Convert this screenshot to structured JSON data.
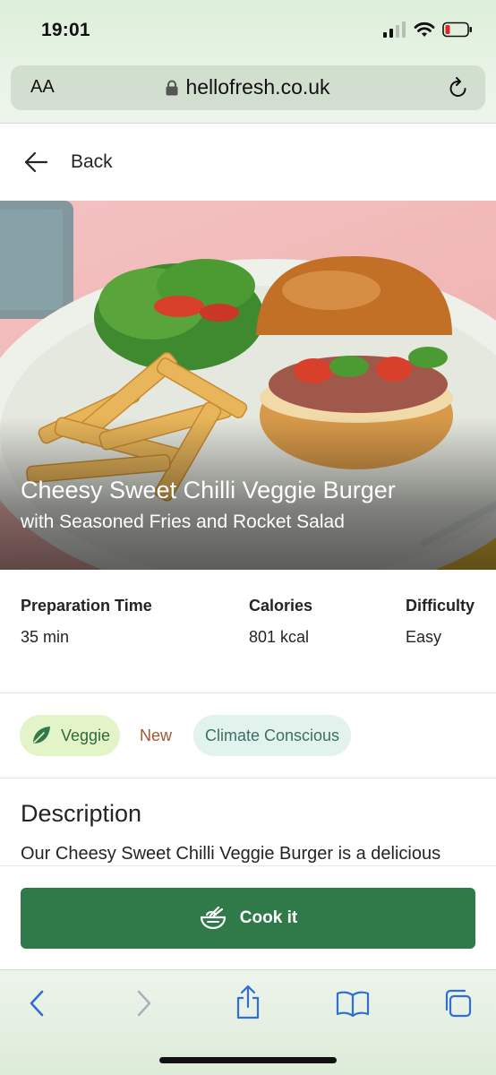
{
  "status_bar": {
    "time": "19:01"
  },
  "browser": {
    "text_size_label": "AA",
    "url": "hellofresh.co.uk"
  },
  "nav": {
    "back_label": "Back"
  },
  "recipe": {
    "title": "Cheesy Sweet Chilli Veggie Burger",
    "subtitle": "with Seasoned Fries and Rocket Salad"
  },
  "info": {
    "prep_label": "Preparation Time",
    "prep_value": "35 min",
    "calories_label": "Calories",
    "calories_value": "801 kcal",
    "difficulty_label": "Difficulty",
    "difficulty_value": "Easy"
  },
  "tags": {
    "veggie": "Veggie",
    "new": "New",
    "climate": "Climate Conscious"
  },
  "description": {
    "heading": "Description",
    "text": "Our Cheesy Sweet Chilli Veggie Burger is a delicious"
  },
  "cta": {
    "cook_label": "Cook it"
  },
  "colors": {
    "brand_green": "#2f7a48",
    "veggie_tag_bg": "#e3f4c8",
    "climate_tag_bg": "#e2f3ee",
    "new_tag_text": "#a2582f",
    "ios_blue": "#2f6fd1"
  },
  "icons": {
    "signal": "cellular-signal-icon",
    "wifi": "wifi-icon",
    "battery": "battery-low-icon",
    "lock": "lock-icon",
    "reload": "reload-icon",
    "back": "arrow-left-icon",
    "leaf": "leaf-icon",
    "bowl": "bowl-icon",
    "share": "share-icon",
    "bookmarks": "book-icon",
    "tabs": "tabs-icon"
  }
}
